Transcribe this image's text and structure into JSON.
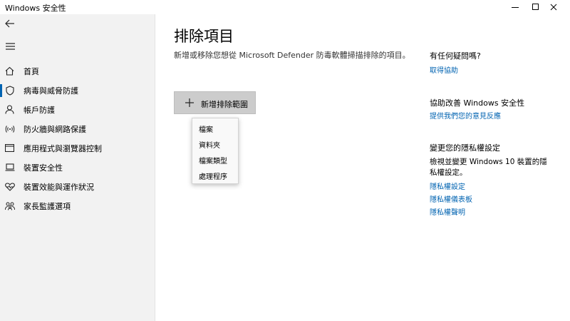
{
  "window": {
    "title": "Windows 安全性"
  },
  "nav": {
    "items": [
      {
        "label": "首頁",
        "icon": "home-icon"
      },
      {
        "label": "病毒與威脅防護",
        "icon": "shield-icon",
        "selected": true
      },
      {
        "label": "帳戶防護",
        "icon": "person-icon"
      },
      {
        "label": "防火牆與網路保護",
        "icon": "wifi-icon"
      },
      {
        "label": "應用程式與瀏覽器控制",
        "icon": "app-window-icon"
      },
      {
        "label": "裝置安全性",
        "icon": "laptop-icon"
      },
      {
        "label": "裝置效能與運作狀況",
        "icon": "heart-icon"
      },
      {
        "label": "家長監護選項",
        "icon": "family-icon"
      }
    ],
    "accent_color": "#0063b1"
  },
  "main": {
    "title": "排除項目",
    "description": "新增或移除您想從 Microsoft Defender 防毒軟體掃描排除的項目。",
    "add_button_label": "新增排除範圍",
    "dropdown_options": [
      "檔案",
      "資料夾",
      "檔案類型",
      "處理程序"
    ]
  },
  "right": {
    "help_heading": "有任何疑問嗎?",
    "help_link": "取得協助",
    "improve_heading": "協助改善 Windows 安全性",
    "feedback_link": "提供我們您的意見反應",
    "privacy_heading": "變更您的隱私權設定",
    "privacy_text": "檢視並變更 Windows 10 裝置的隱私權設定。",
    "privacy_links": [
      "隱私權設定",
      "隱私權儀表板",
      "隱私權聲明"
    ]
  },
  "colors": {
    "link": "#0063b1",
    "sidebar_bg": "#f2f2f2",
    "button_bg": "#cccccc"
  }
}
